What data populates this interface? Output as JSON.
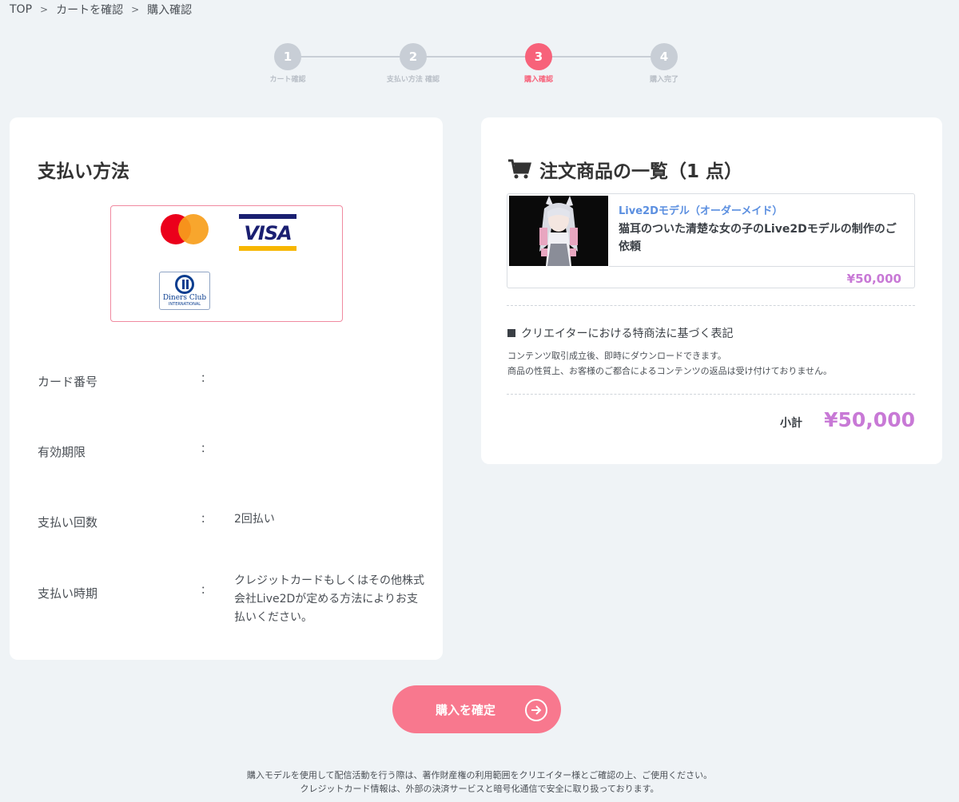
{
  "breadcrumb": {
    "items": [
      "TOP",
      "カートを確認",
      "購入確認"
    ],
    "separator": ">"
  },
  "stepper": {
    "steps": [
      {
        "number": "1",
        "label": "カート確認"
      },
      {
        "number": "2",
        "label": "支払い方法 確認"
      },
      {
        "number": "3",
        "label": "購入確認"
      },
      {
        "number": "4",
        "label": "購入完了"
      }
    ],
    "active_step": 3
  },
  "payment": {
    "title": "支払い方法",
    "accepted_brands": [
      "Mastercard",
      "VISA",
      "Diners Club"
    ],
    "visa_text": "VISA",
    "diners_text": "Diners Club",
    "diners_sub": "INTERNATIONAL",
    "rows": [
      {
        "label": "カード番号",
        "value": ""
      },
      {
        "label": "有効期限",
        "value": ""
      },
      {
        "label": "支払い回数",
        "value": "2回払い"
      },
      {
        "label": "支払い時期",
        "value": "クレジットカードもしくはその他株式会社Live2Dが定める方法によりお支払いください。"
      }
    ],
    "colon": "："
  },
  "order": {
    "title": "注文商品の一覧（1 点）",
    "icon": "cart-icon",
    "item": {
      "category": "Live2Dモデル（オーダーメイド）",
      "name": "猫耳のついた清楚な女の子のLive2Dモデルの制作のご依頼",
      "price": "¥50,000"
    },
    "law": {
      "title": "クリエイターにおける特商法に基づく表記",
      "line1": "コンテンツ取引成立後、即時にダウンロードできます。",
      "line2": "商品の性質上、お客様のご都合によるコンテンツの返品は受け付けておりません。"
    },
    "subtotal_label": "小計",
    "subtotal_value": "¥50,000"
  },
  "confirm_button": {
    "label": "購入を確定"
  },
  "footer": {
    "line1": "購入モデルを使用して配信活動を行う際は、著作財産権の利用範囲をクリエイター様とご確認の上、ご使用ください。",
    "line2": "クレジットカード情報は、外部の決済サービスと暗号化通信で安全に取り扱っております。"
  },
  "colors": {
    "accent_pink": "#f7627a",
    "price_purple": "#c879d6",
    "link_blue": "#5b8fe0",
    "inactive_step": "#c8ced6"
  }
}
